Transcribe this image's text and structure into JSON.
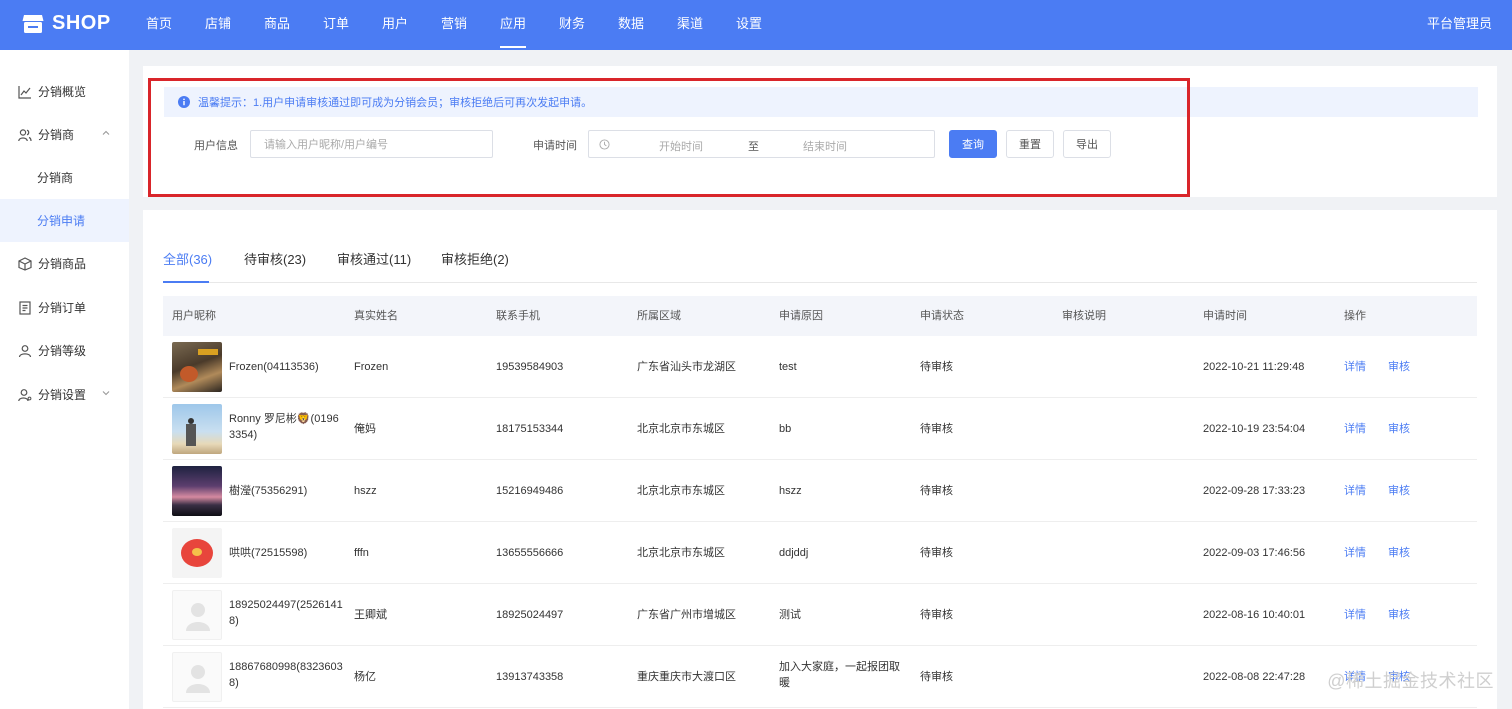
{
  "brand": {
    "name": "SHOP",
    "logo_icon": "store-icon"
  },
  "nav": {
    "items": [
      "首页",
      "店铺",
      "商品",
      "订单",
      "用户",
      "营销",
      "应用",
      "财务",
      "数据",
      "渠道",
      "设置"
    ],
    "active": "应用",
    "admin": "平台管理员"
  },
  "sidebar": {
    "items": [
      {
        "label": "分销概览",
        "icon": "line-chart-icon"
      },
      {
        "label": "分销商",
        "icon": "users-icon",
        "expanded": true
      },
      {
        "label": "分销商"
      },
      {
        "label": "分销申请",
        "active": true
      },
      {
        "label": "分销商品",
        "icon": "box-icon"
      },
      {
        "label": "分销订单",
        "icon": "receipt-icon"
      },
      {
        "label": "分销等级",
        "icon": "user-level-icon"
      },
      {
        "label": "分销设置",
        "icon": "user-settings-icon",
        "collapsed": true
      }
    ]
  },
  "filter": {
    "notice": "温馨提示：1.用户申请审核通过即可成为分销会员；审核拒绝后可再次发起申请。",
    "user_label": "用户信息",
    "user_placeholder": "请输入用户昵称/用户编号",
    "time_label": "申请时间",
    "start_placeholder": "开始时间",
    "range_sep": "至",
    "end_placeholder": "结束时间",
    "query": "查询",
    "reset": "重置",
    "export": "导出"
  },
  "tabs": [
    {
      "label": "全部(36)",
      "active": true
    },
    {
      "label": "待审核(23)"
    },
    {
      "label": "审核通过(11)"
    },
    {
      "label": "审核拒绝(2)"
    }
  ],
  "table": {
    "headers": [
      "用户昵称",
      "真实姓名",
      "联系手机",
      "所属区域",
      "申请原因",
      "申请状态",
      "审核说明",
      "申请时间",
      "操作"
    ],
    "rows": [
      {
        "nick1": "Frozen(04113536)",
        "nick2": "",
        "name": "Frozen",
        "phone": "19539584903",
        "region": "广东省汕头市龙湖区",
        "reason1": "test",
        "reason2": "",
        "status": "待审核",
        "note": "",
        "time": "2022-10-21 11:29:48",
        "detail": "详情",
        "audit": "审核"
      },
      {
        "nick1": "Ronny 罗尼彬🦁(0196",
        "nick2": "3354)",
        "name": "俺妈",
        "phone": "18175153344",
        "region": "北京北京市东城区",
        "reason1": "bb",
        "reason2": "",
        "status": "待审核",
        "note": "",
        "time": "2022-10-19 23:54:04",
        "detail": "详情",
        "audit": "审核"
      },
      {
        "nick1": "樹瀅(75356291)",
        "nick2": "",
        "name": "hszz",
        "phone": "15216949486",
        "region": "北京北京市东城区",
        "reason1": "hszz",
        "reason2": "",
        "status": "待审核",
        "note": "",
        "time": "2022-09-28 17:33:23",
        "detail": "详情",
        "audit": "审核"
      },
      {
        "nick1": "哄哄(72515598)",
        "nick2": "",
        "name": "fffn",
        "phone": "13655556666",
        "region": "北京北京市东城区",
        "reason1": "ddjddj",
        "reason2": "",
        "status": "待审核",
        "note": "",
        "time": "2022-09-03 17:46:56",
        "detail": "详情",
        "audit": "审核"
      },
      {
        "nick1": "18925024497(2526141",
        "nick2": "8)",
        "name": "王卿斌",
        "phone": "18925024497",
        "region": "广东省广州市增城区",
        "reason1": "测试",
        "reason2": "",
        "status": "待审核",
        "note": "",
        "time": "2022-08-16 10:40:01",
        "detail": "详情",
        "audit": "审核"
      },
      {
        "nick1": "18867680998(8323603",
        "nick2": "8)",
        "name": "杨亿",
        "phone": "13913743358",
        "region": "重庆重庆市大渡口区",
        "reason1": "加入大家庭，一起报团取",
        "reason2": "暖",
        "status": "待审核",
        "note": "",
        "time": "2022-08-08 22:47:28",
        "detail": "详情",
        "audit": "审核"
      }
    ]
  },
  "watermark": "@稀土掘金技术社区",
  "colors": {
    "primary": "#4b7cf3",
    "highlight_box": "#d9252a"
  }
}
